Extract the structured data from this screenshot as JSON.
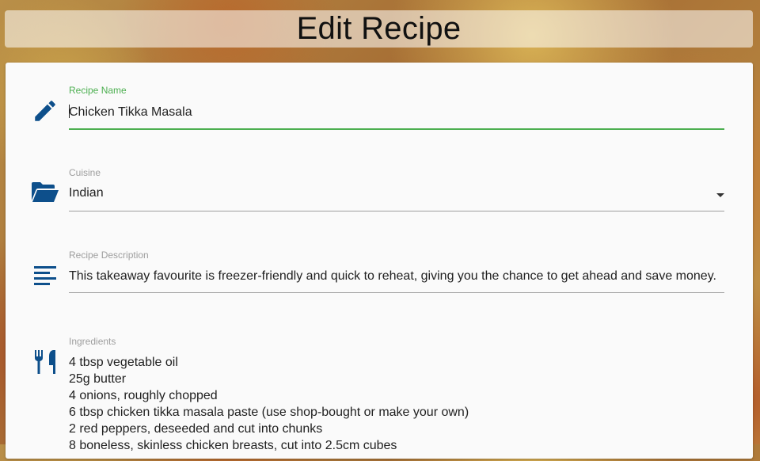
{
  "page": {
    "title": "Edit Recipe"
  },
  "colors": {
    "icon": "#0d4f8b",
    "focus": "#4caf50"
  },
  "form": {
    "recipe_name": {
      "label": "Recipe Name",
      "value": "Chicken Tikka Masala",
      "icon": "pencil-icon"
    },
    "cuisine": {
      "label": "Cuisine",
      "value": "Indian",
      "icon": "folder-open-icon"
    },
    "description": {
      "label": "Recipe Description",
      "value": "This takeaway favourite is freezer-friendly and quick to reheat, giving you the chance to get ahead and save money.",
      "icon": "text-lines-icon"
    },
    "ingredients": {
      "label": "Ingredients",
      "icon": "utensils-icon",
      "lines": [
        "4 tbsp vegetable oil",
        "25g butter",
        "4 onions, roughly chopped",
        "6 tbsp chicken tikka masala paste (use shop-bought or make your own)",
        "2 red peppers, deseeded and cut into chunks",
        "8 boneless, skinless chicken breasts, cut into 2.5cm cubes"
      ]
    }
  }
}
